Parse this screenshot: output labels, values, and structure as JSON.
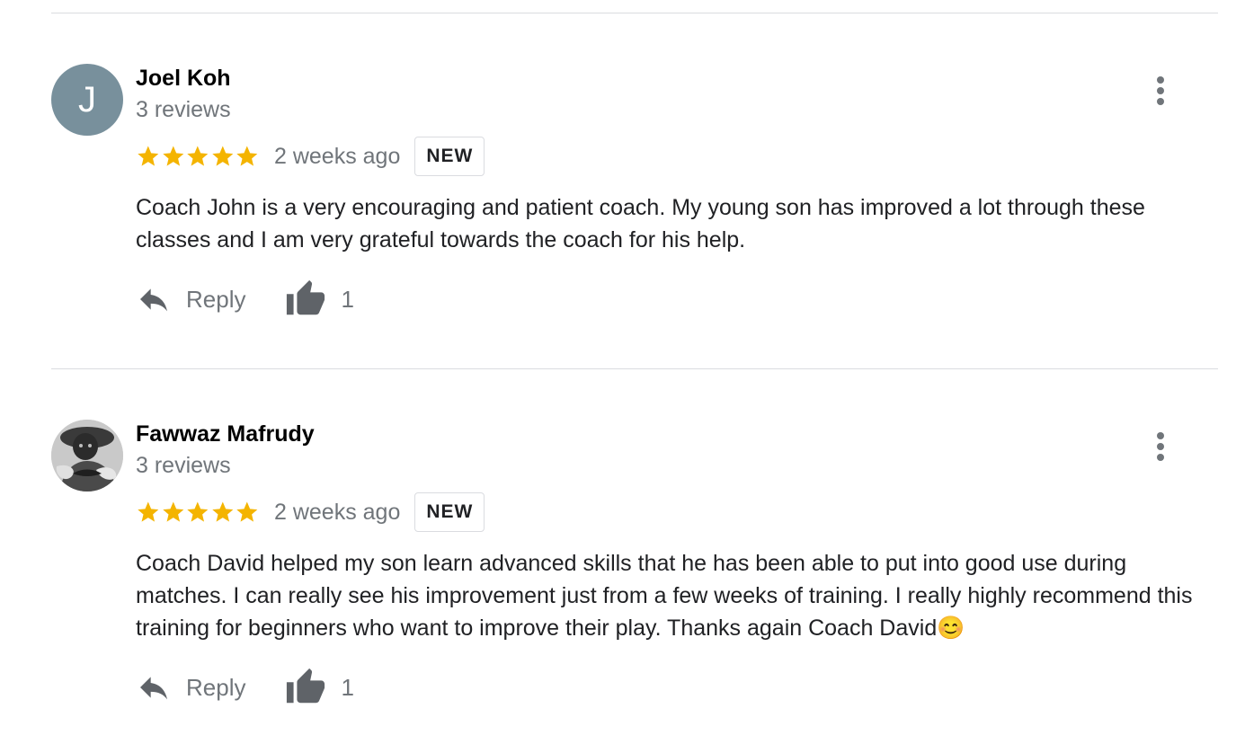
{
  "reviews": [
    {
      "author": "Joel Koh",
      "avatar_letter": "J",
      "avatar_color": "#78909c",
      "review_count": "3 reviews",
      "rating": 5,
      "rating_max": 5,
      "date": "2 weeks ago",
      "badge": "NEW",
      "text": "Coach John is a very encouraging and patient coach. My young son has improved a lot through these classes and I am very grateful towards the coach for his help.",
      "reply_label": "Reply",
      "like_count": "1",
      "icons": {
        "more": "more-vert-icon",
        "reply": "reply-icon",
        "like": "thumb-up-icon"
      }
    },
    {
      "author": "Fawwaz Mafrudy",
      "avatar_type": "photo",
      "review_count": "3 reviews",
      "rating": 5,
      "rating_max": 5,
      "date": "2 weeks ago",
      "badge": "NEW",
      "text": "Coach David helped my son learn advanced skills that he has been able to put into good use during matches. I can really see his improvement just from a few weeks of training. I really highly recommend this training for beginners who want to improve their play. Thanks again Coach David😊",
      "reply_label": "Reply",
      "like_count": "1",
      "icons": {
        "more": "more-vert-icon",
        "reply": "reply-icon",
        "like": "thumb-up-icon"
      }
    }
  ],
  "colors": {
    "star": "#f4b400",
    "secondary_text": "#70757a",
    "divider": "#dadce0"
  }
}
